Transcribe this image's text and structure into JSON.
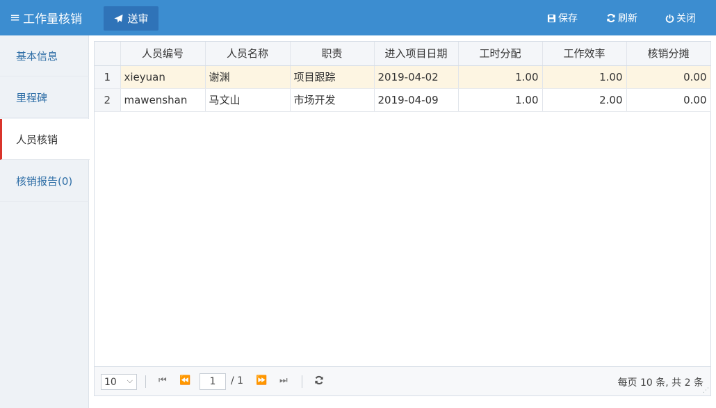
{
  "header": {
    "title": "工作量核销",
    "menu_icon": "≡",
    "send_label": "送审",
    "save_label": "保存",
    "refresh_label": "刷新",
    "close_label": "关闭",
    "bg_color": "#3c8dd0"
  },
  "sidebar": {
    "items": [
      {
        "label": "基本信息"
      },
      {
        "label": "里程碑"
      },
      {
        "label": "人员核销"
      },
      {
        "label": "核销报告(0)"
      }
    ],
    "active_index": 2,
    "active_marker_color": "#d9342b"
  },
  "grid": {
    "columns": [
      "人员编号",
      "人员名称",
      "职责",
      "进入项目日期",
      "工时分配",
      "工作效率",
      "核销分摊"
    ],
    "rows": [
      {
        "idx": "1",
        "code": "xieyuan",
        "name": "谢渊",
        "role": "项目跟踪",
        "date": "2019-04-02",
        "hours": "1.00",
        "efficiency": "1.00",
        "share": "0.00"
      },
      {
        "idx": "2",
        "code": "mawenshan",
        "name": "马文山",
        "role": "市场开发",
        "date": "2019-04-09",
        "hours": "1.00",
        "efficiency": "2.00",
        "share": "0.00"
      }
    ],
    "selected_row_index": 0
  },
  "pager": {
    "page_size": "10",
    "current_page": "1",
    "total_pages": "/ 1",
    "info": "每页 10 条, 共 2 条"
  }
}
